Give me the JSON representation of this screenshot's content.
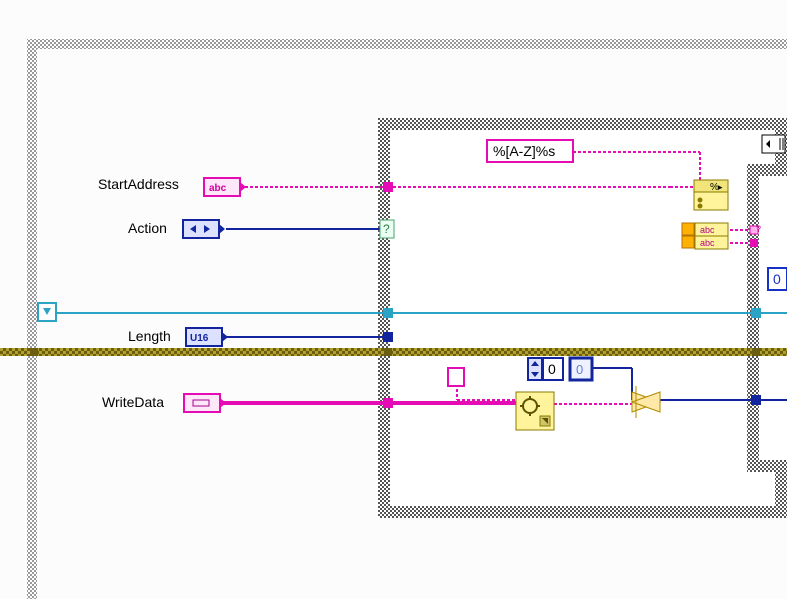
{
  "terminals": {
    "startAddress": {
      "label": "StartAddress",
      "type_tag": "abc"
    },
    "action": {
      "label": "Action",
      "type_tag": "◄ ►"
    },
    "length": {
      "label": "Length",
      "type_tag": "U16"
    },
    "writeData": {
      "label": "WriteData",
      "type_tag": "▭"
    }
  },
  "constants": {
    "scanFormat": "%[A-Z]%s",
    "zeroA": "0",
    "zeroB": "0"
  },
  "nodes": {
    "caseTunnelQ": "?",
    "scanNode": {
      "header": "%",
      "out1": "abc",
      "out2": "abc"
    }
  }
}
